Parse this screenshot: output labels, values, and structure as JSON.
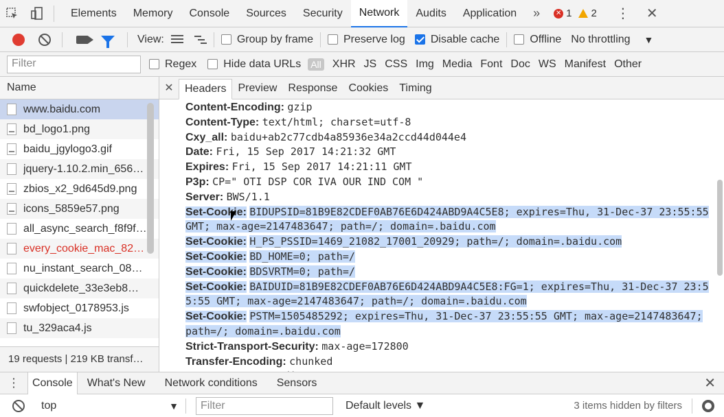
{
  "tabs": [
    "Elements",
    "Memory",
    "Console",
    "Sources",
    "Security",
    "Network",
    "Audits",
    "Application"
  ],
  "tabs_more": "»",
  "errors_count": "1",
  "warnings_count": "2",
  "toolbar": {
    "view_label": "View:",
    "group_by_frame": "Group by frame",
    "preserve_log": "Preserve log",
    "disable_cache": "Disable cache",
    "offline": "Offline",
    "throttling": "No throttling"
  },
  "filter": {
    "placeholder": "Filter",
    "regex": "Regex",
    "hide_data_urls": "Hide data URLs",
    "types": [
      "All",
      "XHR",
      "JS",
      "CSS",
      "Img",
      "Media",
      "Font",
      "Doc",
      "WS",
      "Manifest",
      "Other"
    ]
  },
  "requests": {
    "header": "Name",
    "items": [
      {
        "name": "www.baidu.com",
        "selected": true,
        "red": false
      },
      {
        "name": "bd_logo1.png",
        "selected": false,
        "red": false
      },
      {
        "name": "baidu_jgylogo3.gif",
        "selected": false,
        "red": false
      },
      {
        "name": "jquery-1.10.2.min_656…",
        "selected": false,
        "red": false
      },
      {
        "name": "zbios_x2_9d645d9.png",
        "selected": false,
        "red": false
      },
      {
        "name": "icons_5859e57.png",
        "selected": false,
        "red": false
      },
      {
        "name": "all_async_search_f8f9f.…",
        "selected": false,
        "red": false
      },
      {
        "name": "every_cookie_mac_82…",
        "selected": false,
        "red": true
      },
      {
        "name": "nu_instant_search_080…",
        "selected": false,
        "red": false
      },
      {
        "name": "quickdelete_33e3eb8…",
        "selected": false,
        "red": false
      },
      {
        "name": "swfobject_0178953.js",
        "selected": false,
        "red": false
      },
      {
        "name": "tu_329aca4.js",
        "selected": false,
        "red": false
      }
    ],
    "status": "19 requests | 219 KB transf…"
  },
  "detail_tabs": [
    "Headers",
    "Preview",
    "Response",
    "Cookies",
    "Timing"
  ],
  "headers": [
    {
      "key": "Content-Encoding:",
      "value": "gzip",
      "hl": false
    },
    {
      "key": "Content-Type:",
      "value": "text/html; charset=utf-8",
      "hl": false
    },
    {
      "key": "Cxy_all:",
      "value": "baidu+ab2c77cdb4a85936e34a2ccd44d044e4",
      "hl": false
    },
    {
      "key": "Date:",
      "value": "Fri, 15 Sep 2017 14:21:32 GMT",
      "hl": false
    },
    {
      "key": "Expires:",
      "value": "Fri, 15 Sep 2017 14:21:11 GMT",
      "hl": false
    },
    {
      "key": "P3p:",
      "value": "CP=\" OTI DSP COR IVA OUR IND COM \"",
      "hl": false
    },
    {
      "key": "Server:",
      "value": "BWS/1.1",
      "hl": false
    },
    {
      "key": "Set-Cookie:",
      "value": "BIDUPSID=81B9E82CDEF0AB76E6D424ABD9A4C5E8; expires=Thu, 31-Dec-37 23:55:55 GMT; max-age=2147483647; path=/; domain=.baidu.com",
      "hl": true
    },
    {
      "key": "Set-Cookie:",
      "value": "H_PS_PSSID=1469_21082_17001_20929; path=/; domain=.baidu.com",
      "hl": true
    },
    {
      "key": "Set-Cookie:",
      "value": "BD_HOME=0; path=/",
      "hl": true
    },
    {
      "key": "Set-Cookie:",
      "value": "BDSVRTM=0; path=/",
      "hl": true
    },
    {
      "key": "Set-Cookie:",
      "value": "BAIDUID=81B9E82CDEF0AB76E6D424ABD9A4C5E8:FG=1; expires=Thu, 31-Dec-37 23:55:55 GMT; max-age=2147483647; path=/; domain=.baidu.com",
      "hl": true
    },
    {
      "key": "Set-Cookie:",
      "value": "PSTM=1505485292; expires=Thu, 31-Dec-37 23:55:55 GMT; max-age=2147483647; path=/; domain=.baidu.com",
      "hl": true
    },
    {
      "key": "Strict-Transport-Security:",
      "value": "max-age=172800",
      "hl": false
    },
    {
      "key": "Transfer-Encoding:",
      "value": "chunked",
      "hl": false
    },
    {
      "key": "Vary:",
      "value": "Accept-Encoding",
      "hl": false
    }
  ],
  "drawer": {
    "tabs": [
      "Console",
      "What's New",
      "Network conditions",
      "Sensors"
    ],
    "context": "top",
    "filter_placeholder": "Filter",
    "levels": "Default levels ▼",
    "hidden_msg": "3 items hidden by filters"
  },
  "colors": {
    "accent": "#1a73e8",
    "highlight": "#c6dbf9",
    "record": "#e03c31",
    "error": "#d93025",
    "warning": "#f2a600"
  }
}
